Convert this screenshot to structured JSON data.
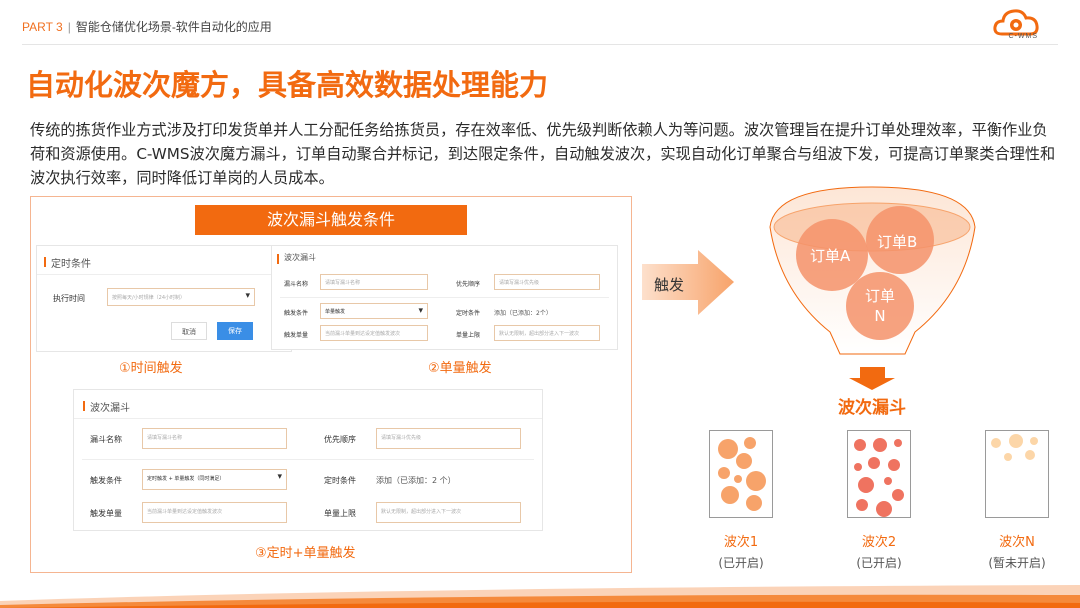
{
  "header": {
    "part": "PART 3",
    "divider": "|",
    "subtitle": "智能仓储优化场景-软件自动化的应用",
    "logo_text": "C-WMS",
    "brand_color": "#f26a10"
  },
  "title": "自动化波次魔方，具备高效数据处理能力",
  "paragraph": "传统的拣货作业方式涉及打印发货单并人工分配任务给拣货员，存在效率低、优先级判断依赖人为等问题。波次管理旨在提升订单处理效率，平衡作业负荷和资源使用。C-WMS波次魔方漏斗，订单自动聚合并标记，到达限定条件，自动触发波次，实现自动化订单聚合与组波下发，可提高订单聚类合理性和波次执行效率，同时降低订单岗的人员成本。",
  "left": {
    "banner": "波次漏斗触发条件",
    "panel1": {
      "title": "定时条件",
      "time_label": "执行时间",
      "time_placeholder": "按照每天/小时规律（24小时制）",
      "cancel": "取消",
      "save": "保存"
    },
    "panel2": {
      "title": "波次漏斗",
      "name_label": "漏斗名称",
      "name_placeholder": "请填写漏斗名称",
      "priority_label": "优先顺序",
      "priority_placeholder": "请填写漏斗优先级",
      "trigger_label": "触发条件",
      "trigger_value": "单量触发",
      "timer_label": "定时条件",
      "timer_value": "添加（已添加：2个）",
      "order_label": "触发单量",
      "order_placeholder": "当前漏斗单量到达设定值触发波次",
      "limit_label": "单量上限",
      "limit_placeholder": "默认无限制，超出部分进入下一波次"
    },
    "panel3": {
      "title": "波次漏斗",
      "name_label": "漏斗名称",
      "name_placeholder": "请填写漏斗名称",
      "priority_label": "优先顺序",
      "priority_placeholder": "请填写漏斗优先级",
      "trigger_label": "触发条件",
      "trigger_value": "定时触发 + 单量触发（同时满足）",
      "timer_label": "定时条件",
      "timer_value": "添加（已添加：2 个）",
      "order_label": "触发单量",
      "order_placeholder": "当前漏斗单量到达设定值触发波次",
      "limit_label": "单量上限",
      "limit_placeholder": "默认无限制，超出部分进入下一波次"
    },
    "caption1": "①时间触发",
    "caption2": "②单量触发",
    "caption3": "③定时+单量触发"
  },
  "right": {
    "trigger": "触发",
    "order_a": "订单A",
    "order_b": "订单B",
    "order_n_line1": "订单",
    "order_n_line2": "N",
    "funnel_label": "波次漏斗",
    "waves": [
      {
        "label": "波次1",
        "status": "(已开启)"
      },
      {
        "label": "波次2",
        "status": "(已开启)"
      },
      {
        "label": "波次N",
        "status": "(暂未开启)"
      }
    ]
  }
}
